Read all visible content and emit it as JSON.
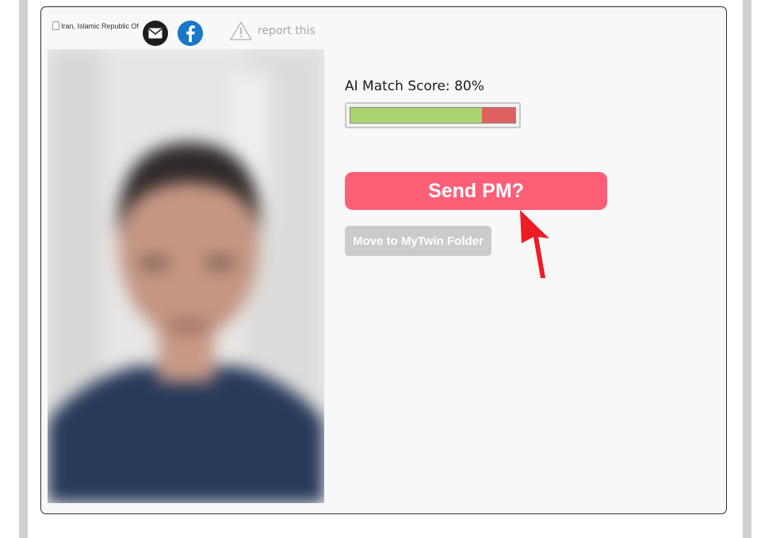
{
  "profile": {
    "country_alt": "Iran, Islamic Republic Of",
    "share_icons": [
      "email-icon",
      "facebook-icon"
    ],
    "report_label": "report this"
  },
  "match": {
    "score_label": "AI Match Score: 80%",
    "score_fraction": 0.8
  },
  "actions": {
    "send_pm_label": "Send PM?",
    "move_folder_label": "Move to MyTwin Folder"
  },
  "colors": {
    "send_button": "#fd5f77",
    "folder_button": "#cbcbcb",
    "score_fill": "#aad472",
    "score_rest": "#e06060",
    "annotation_arrow": "#ee1c25"
  }
}
